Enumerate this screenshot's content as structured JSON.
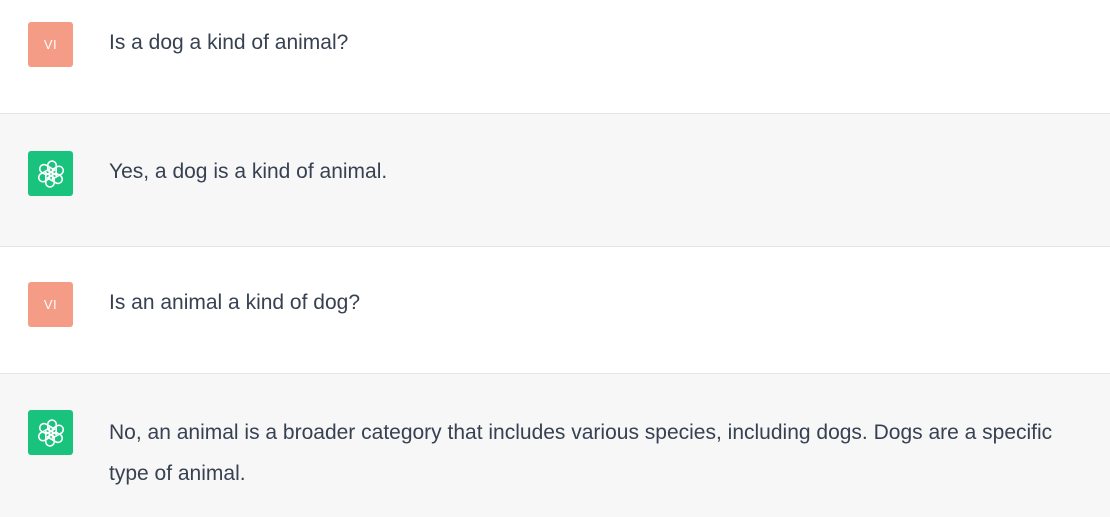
{
  "conversation": {
    "messages": [
      {
        "role": "user",
        "avatar_text": "VI",
        "text": "Is a dog a kind of animal?"
      },
      {
        "role": "assistant",
        "avatar_icon": "openai-logo-icon",
        "text": "Yes, a dog is a kind of animal."
      },
      {
        "role": "user",
        "avatar_text": "VI",
        "text": "Is an animal a kind of dog?"
      },
      {
        "role": "assistant",
        "avatar_icon": "openai-logo-icon",
        "text": "No, an animal is a broader category that includes various species, including dogs. Dogs are a specific type of animal."
      }
    ]
  },
  "colors": {
    "user_avatar": "#f49c85",
    "assistant_avatar": "#19c37d",
    "assistant_bg": "#f7f7f8",
    "text": "#374151"
  }
}
